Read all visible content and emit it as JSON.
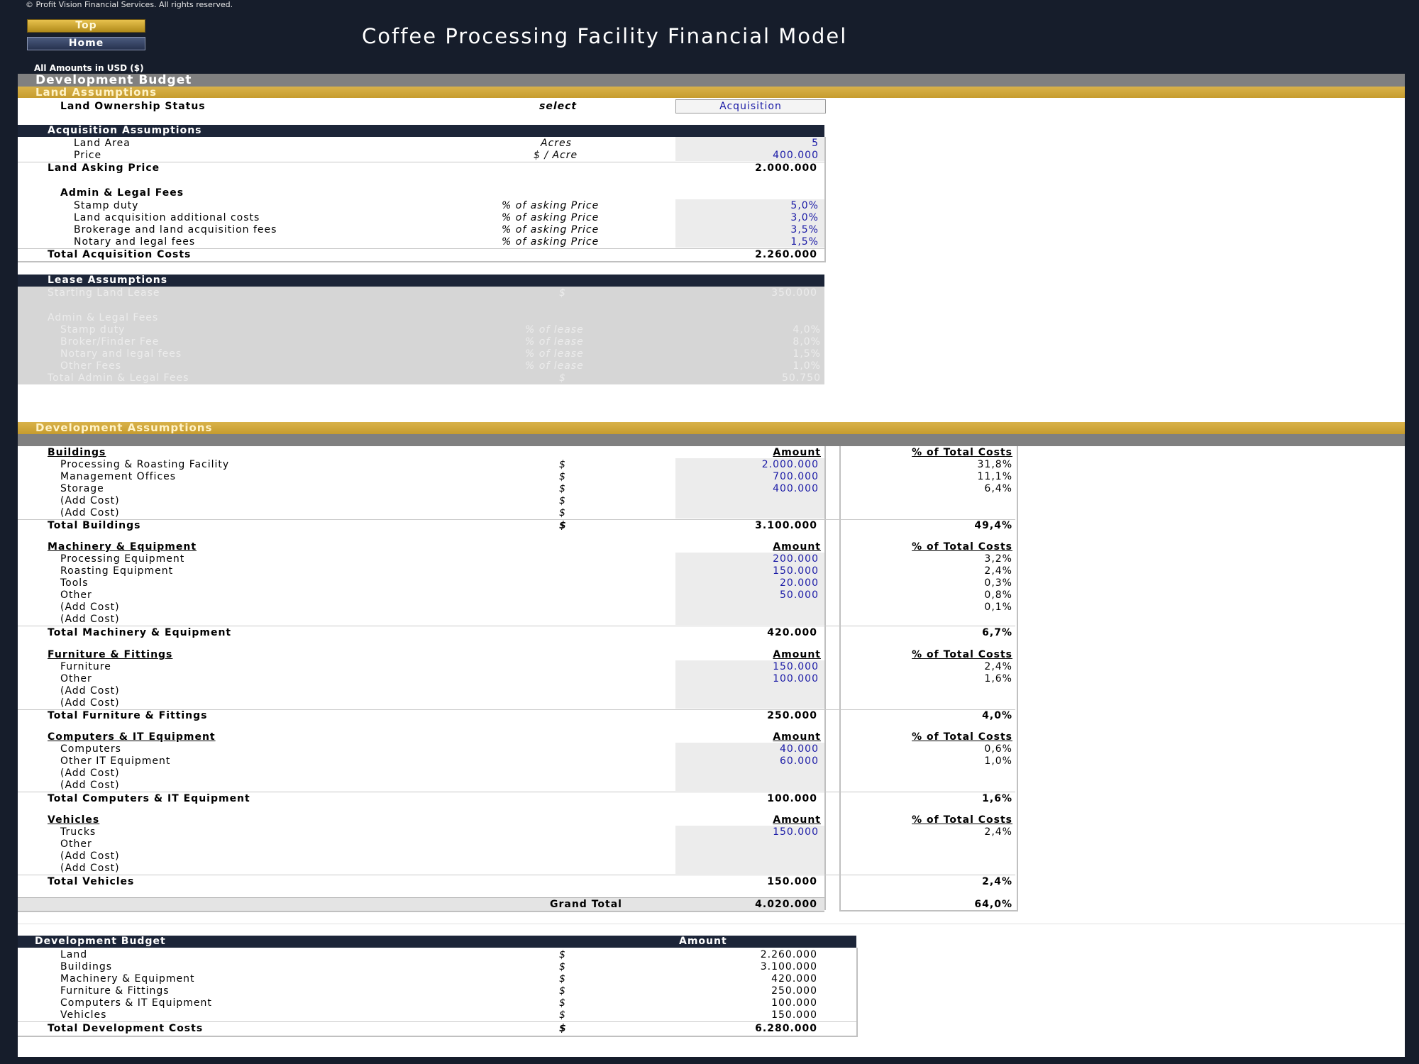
{
  "header": {
    "copyright": "© Profit Vision Financial Services. All rights reserved.",
    "top_button": "Top",
    "home_button": "Home",
    "title": "Coffee Processing Facility Financial Model",
    "amounts_note": "All Amounts in  USD ($)"
  },
  "sections": {
    "development_budget": "Development Budget",
    "land_assumptions": "Land Assumptions",
    "development_assumptions": "Development Assumptions"
  },
  "land": {
    "ownership_label": "Land Ownership Status",
    "ownership_unit": "select",
    "ownership_value": "Acquisition"
  },
  "acquisition": {
    "header": "Acquisition Assumptions",
    "land_area_label": "Land Area",
    "land_area_unit": "Acres",
    "land_area_value": "5",
    "price_label": "Price",
    "price_unit": "$ / Acre",
    "price_value": "400.000",
    "asking_label": "Land Asking Price",
    "asking_value": "2.000.000",
    "admin_header": "Admin & Legal Fees",
    "fees": [
      {
        "label": "Stamp duty",
        "unit": "% of asking Price",
        "value": "5,0%"
      },
      {
        "label": "Land acquisition additional costs",
        "unit": "% of asking Price",
        "value": "3,0%"
      },
      {
        "label": "Brokerage and land acquisition fees",
        "unit": "% of asking Price",
        "value": "3,5%"
      },
      {
        "label": "Notary and legal fees",
        "unit": "% of asking Price",
        "value": "1,5%"
      }
    ],
    "total_label": "Total Acquisition Costs",
    "total_value": "2.260.000"
  },
  "lease": {
    "header": "Lease Assumptions",
    "starting_label": "Starting Land Lease",
    "starting_unit": "$",
    "starting_value": "350.000",
    "admin_header": "Admin & Legal Fees",
    "fees": [
      {
        "label": "Stamp duty",
        "unit": "% of lease",
        "value": "4,0%"
      },
      {
        "label": "Broker/Finder Fee",
        "unit": "% of lease",
        "value": "8,0%"
      },
      {
        "label": "Notary and legal fees",
        "unit": "% of lease",
        "value": "1,5%"
      },
      {
        "label": "Other Fees",
        "unit": "% of lease",
        "value": "1,0%"
      }
    ],
    "total_label": "Total Admin & Legal Fees",
    "total_unit": "$",
    "total_value": "50.750"
  },
  "dev": {
    "amount_header": "Amount",
    "pct_header": "% of Total Costs",
    "buildings": {
      "title": "Buildings",
      "items": [
        {
          "label": "Processing & Roasting Facility",
          "unit": "$",
          "value": "2.000.000",
          "pct": "31,8%"
        },
        {
          "label": "Management Offices",
          "unit": "$",
          "value": "700.000",
          "pct": "11,1%"
        },
        {
          "label": "Storage",
          "unit": "$",
          "value": "400.000",
          "pct": "6,4%"
        },
        {
          "label": "(Add Cost)",
          "unit": "$",
          "value": "",
          "pct": ""
        },
        {
          "label": "(Add Cost)",
          "unit": "$",
          "value": "",
          "pct": ""
        }
      ],
      "total_label": "Total Buildings",
      "total_unit": "$",
      "total_value": "3.100.000",
      "total_pct": "49,4%"
    },
    "machinery": {
      "title": "Machinery & Equipment",
      "items": [
        {
          "label": "Processing Equipment",
          "value": "200.000",
          "pct": "3,2%"
        },
        {
          "label": "Roasting Equipment",
          "value": "150.000",
          "pct": "2,4%"
        },
        {
          "label": "Tools",
          "value": "20.000",
          "pct": "0,3%"
        },
        {
          "label": "Other",
          "value": "50.000",
          "pct": "0,8%"
        },
        {
          "label": "(Add Cost)",
          "value": "",
          "pct": "0,1%"
        },
        {
          "label": "(Add Cost)",
          "value": "",
          "pct": ""
        }
      ],
      "total_label": "Total Machinery & Equipment",
      "total_value": "420.000",
      "total_pct": "6,7%"
    },
    "furniture": {
      "title": "Furniture & Fittings",
      "items": [
        {
          "label": "Furniture",
          "value": "150.000",
          "pct": "2,4%"
        },
        {
          "label": "Other",
          "value": "100.000",
          "pct": "1,6%"
        },
        {
          "label": "(Add Cost)",
          "value": "",
          "pct": ""
        },
        {
          "label": "(Add Cost)",
          "value": "",
          "pct": ""
        }
      ],
      "total_label": "Total Furniture & Fittings",
      "total_value": "250.000",
      "total_pct": "4,0%"
    },
    "computers": {
      "title": "Computers & IT Equipment",
      "items": [
        {
          "label": "Computers",
          "value": "40.000",
          "pct": "0,6%"
        },
        {
          "label": "Other IT Equipment",
          "value": "60.000",
          "pct": "1,0%"
        },
        {
          "label": "(Add Cost)",
          "value": "",
          "pct": ""
        },
        {
          "label": "(Add Cost)",
          "value": "",
          "pct": ""
        }
      ],
      "total_label": "Total Computers & IT Equipment",
      "total_value": "100.000",
      "total_pct": "1,6%"
    },
    "vehicles": {
      "title": "Vehicles",
      "items": [
        {
          "label": "Trucks",
          "value": "150.000",
          "pct": "2,4%"
        },
        {
          "label": "Other",
          "value": "",
          "pct": ""
        },
        {
          "label": "(Add Cost)",
          "value": "",
          "pct": ""
        },
        {
          "label": "(Add Cost)",
          "value": "",
          "pct": ""
        }
      ],
      "total_label": "Total Vehicles",
      "total_value": "150.000",
      "total_pct": "2,4%"
    },
    "grand_total_label": "Grand Total",
    "grand_total_value": "4.020.000",
    "grand_total_pct": "64,0%"
  },
  "budget": {
    "header": "Development Budget",
    "amount_header": "Amount",
    "rows": [
      {
        "label": "Land",
        "unit": "$",
        "value": "2.260.000"
      },
      {
        "label": "Buildings",
        "unit": "$",
        "value": "3.100.000"
      },
      {
        "label": "Machinery & Equipment",
        "unit": "$",
        "value": "420.000"
      },
      {
        "label": "Furniture & Fittings",
        "unit": "$",
        "value": "250.000"
      },
      {
        "label": "Computers & IT Equipment",
        "unit": "$",
        "value": "100.000"
      },
      {
        "label": "Vehicles",
        "unit": "$",
        "value": "150.000"
      }
    ],
    "total_label": "Total Development Costs",
    "total_unit": "$",
    "total_value": "6.280.000"
  },
  "colors": {
    "background": "#161d2b",
    "gold": "#c69c2e",
    "navy": "#1c2538",
    "input_blue": "#1a1aa6",
    "input_cell": "#ececec"
  }
}
